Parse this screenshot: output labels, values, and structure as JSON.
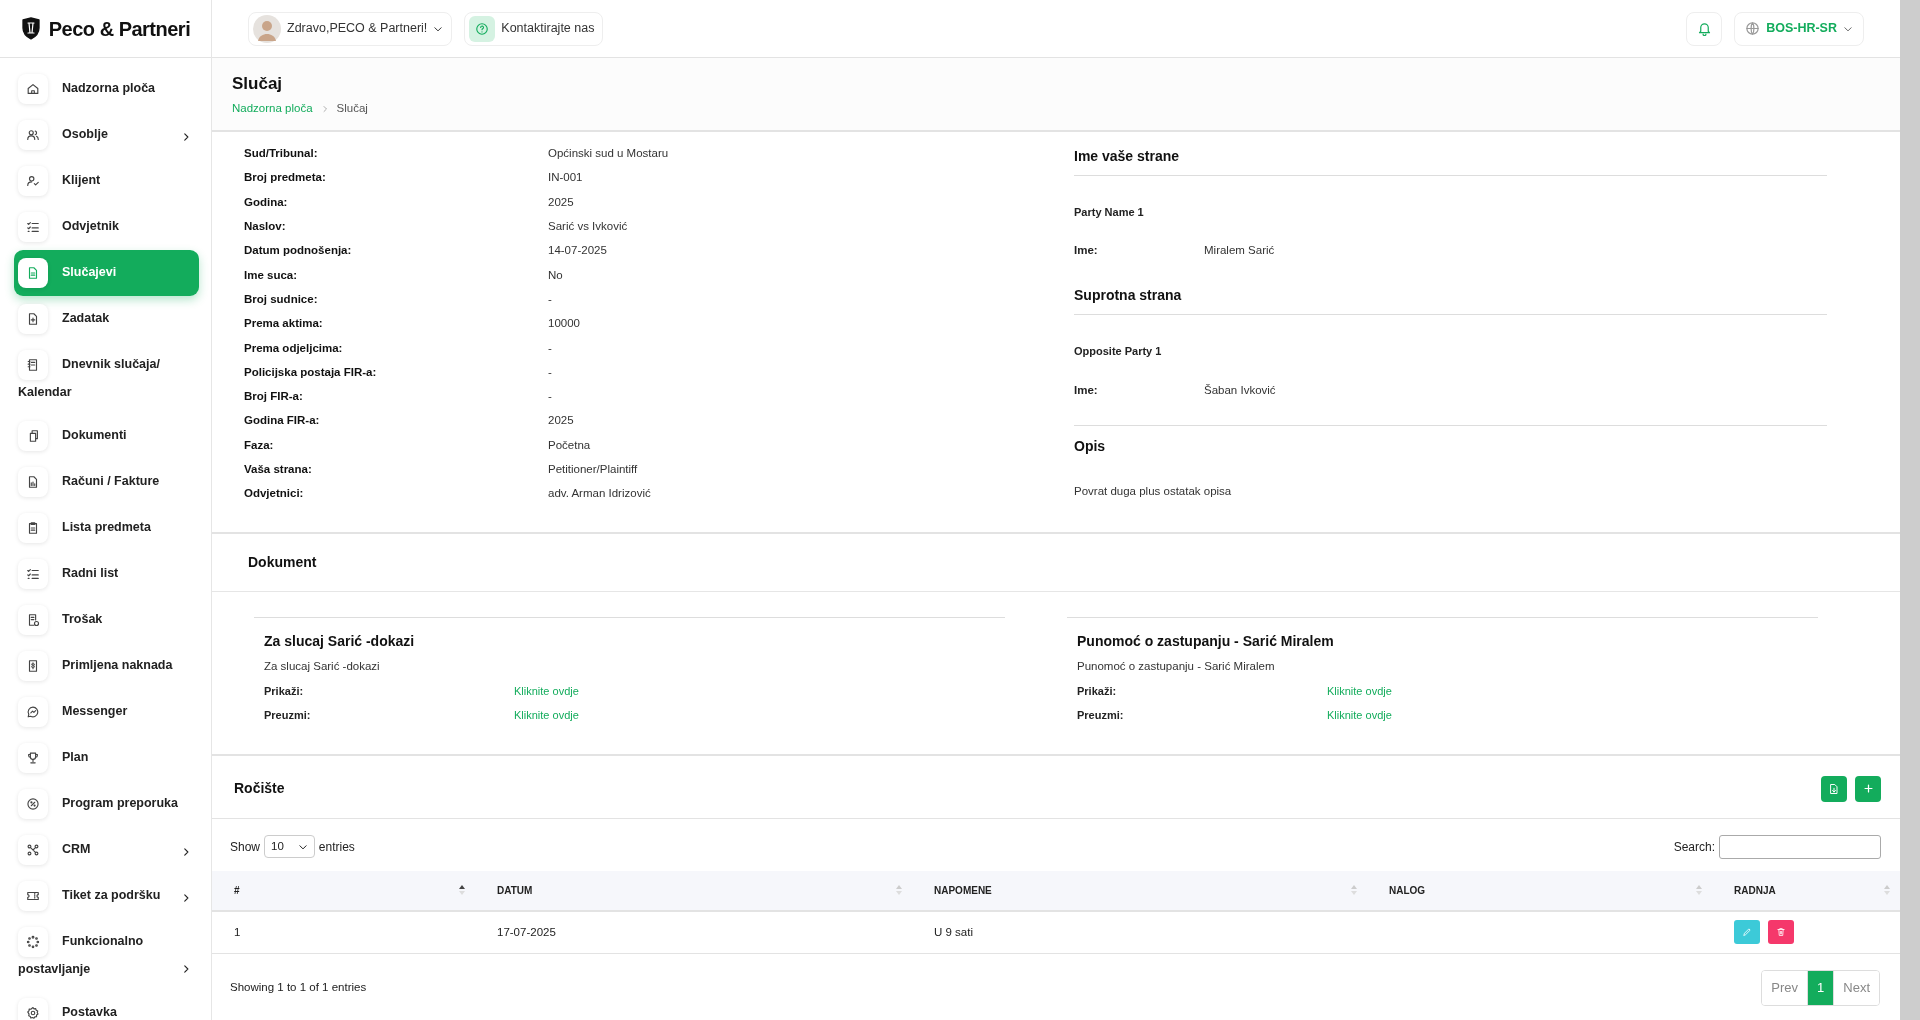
{
  "brand": {
    "name": "Peco & Partneri"
  },
  "sidebar": {
    "items": [
      {
        "label": "Nadzorna ploča",
        "selected": false,
        "expandable": false
      },
      {
        "label": "Osoblje",
        "selected": false,
        "expandable": true
      },
      {
        "label": "Klijent",
        "selected": false,
        "expandable": false
      },
      {
        "label": "Odvjetnik",
        "selected": false,
        "expandable": false
      },
      {
        "label": "Slučajevi",
        "selected": true,
        "expandable": false
      },
      {
        "label": "Zadatak",
        "selected": false,
        "expandable": false
      },
      {
        "label": "Dnevnik slučaja/ Kalendar",
        "selected": false,
        "expandable": false
      },
      {
        "label": "Dokumenti",
        "selected": false,
        "expandable": false
      },
      {
        "label": "Računi / Fakture",
        "selected": false,
        "expandable": false
      },
      {
        "label": "Lista predmeta",
        "selected": false,
        "expandable": false
      },
      {
        "label": "Radni list",
        "selected": false,
        "expandable": false
      },
      {
        "label": "Trošak",
        "selected": false,
        "expandable": false
      },
      {
        "label": "Primljena naknada",
        "selected": false,
        "expandable": false
      },
      {
        "label": "Messenger",
        "selected": false,
        "expandable": false
      },
      {
        "label": "Plan",
        "selected": false,
        "expandable": false
      },
      {
        "label": "Program preporuka",
        "selected": false,
        "expandable": false
      },
      {
        "label": "CRM",
        "selected": false,
        "expandable": true
      },
      {
        "label": "Tiket za podršku",
        "selected": false,
        "expandable": true
      },
      {
        "label": "Funkcionalno postavljanje",
        "selected": false,
        "expandable": true
      },
      {
        "label": "Postavka",
        "selected": false,
        "expandable": false
      }
    ]
  },
  "header": {
    "greeting": "Zdravo,PECO & Partneri!",
    "contact": "Kontaktirajte nas",
    "language": "BOS-HR-SR"
  },
  "page": {
    "title": "Slučaj",
    "breadcrumb": [
      "Nadzorna ploča",
      "Slučaj"
    ]
  },
  "details": [
    {
      "label": "Sud/Tribunal:",
      "value": "Općinski sud u Mostaru"
    },
    {
      "label": "Broj predmeta:",
      "value": "IN-001"
    },
    {
      "label": "Godina:",
      "value": "2025"
    },
    {
      "label": "Naslov:",
      "value": "Sarić vs Ivković"
    },
    {
      "label": "Datum podnošenja:",
      "value": "14-07-2025"
    },
    {
      "label": "Ime suca:",
      "value": "No"
    },
    {
      "label": "Broj sudnice:",
      "value": "-"
    },
    {
      "label": "Prema aktima:",
      "value": "10000"
    },
    {
      "label": "Prema odjeljcima:",
      "value": "-"
    },
    {
      "label": "Policijska postaja FIR-a:",
      "value": "-"
    },
    {
      "label": "Broj FIR-a:",
      "value": "-"
    },
    {
      "label": "Godina FIR-a:",
      "value": "2025"
    },
    {
      "label": "Faza:",
      "value": "Početna"
    },
    {
      "label": "Vaša strana:",
      "value": "Petitioner/Plaintiff"
    },
    {
      "label": "Odvjetnici:",
      "value": "adv. Arman Idrizović"
    }
  ],
  "parties": [
    {
      "heading": "Ime vaše strane",
      "party": "Party Name 1",
      "label": "Ime:",
      "value": "Miralem Sarić"
    },
    {
      "heading": "Suprotna strana",
      "party": "Opposite Party 1",
      "label": "Ime:",
      "value": "Šaban Ivković"
    }
  ],
  "description": {
    "heading": "Opis",
    "text": "Povrat duga plus ostatak opisa"
  },
  "documents": {
    "heading": "Dokument",
    "items": [
      {
        "title": "Za slucaj Sarić -dokazi",
        "subtitle": "Za slucaj Sarić -dokazi",
        "rows": [
          {
            "label": "Prikaži:",
            "link": "Kliknite ovdje"
          },
          {
            "label": "Preuzmi:",
            "link": "Kliknite ovdje"
          }
        ]
      },
      {
        "title": "Punomoć o zastupanju - Sarić Miralem",
        "subtitle": "Punomoć o zastupanju - Sarić Miralem",
        "rows": [
          {
            "label": "Prikaži:",
            "link": "Kliknite ovdje"
          },
          {
            "label": "Preuzmi:",
            "link": "Kliknite ovdje"
          }
        ]
      }
    ]
  },
  "hearings": {
    "heading": "Ročište",
    "show_label": "Show",
    "page_length": "10",
    "entries_label": "entries",
    "search_label": "Search:",
    "columns": [
      {
        "label": "#",
        "sorted": true
      },
      {
        "label": "DATUM",
        "sorted": false
      },
      {
        "label": "NAPOMENE",
        "sorted": false
      },
      {
        "label": "NALOG",
        "sorted": false
      },
      {
        "label": "RADNJA",
        "sorted": false
      }
    ],
    "rows": [
      {
        "number": "1",
        "date": "17-07-2025",
        "notes": "U 9 sati"
      }
    ],
    "info": "Showing 1 to 1 of 1 entries",
    "pagination": [
      {
        "label": "Prev",
        "selected": false
      },
      {
        "label": "1",
        "selected": true
      },
      {
        "label": "Next",
        "selected": false
      }
    ]
  }
}
